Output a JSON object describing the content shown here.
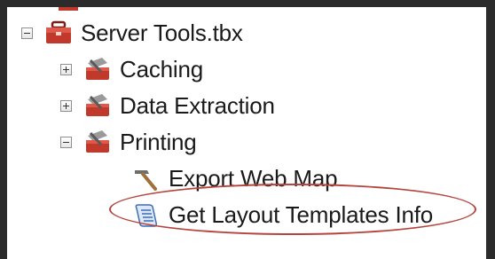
{
  "tree": {
    "root": {
      "label": "Server Tools.tbx",
      "expanded": true,
      "icon": "red-toolbox-icon"
    },
    "toolsets": [
      {
        "label": "Caching",
        "expanded": false,
        "icon": "toolset-icon"
      },
      {
        "label": "Data Extraction",
        "expanded": false,
        "icon": "toolset-icon"
      },
      {
        "label": "Printing",
        "expanded": true,
        "icon": "toolset-icon"
      }
    ],
    "tools": [
      {
        "label": "Export Web Map",
        "icon": "hammer-tool-icon"
      },
      {
        "label": "Get Layout Templates Info",
        "icon": "script-tool-icon"
      }
    ]
  },
  "colors": {
    "highlight": "#b5453c",
    "toolbox_red": "#c0392b",
    "background": "#2b2b2b"
  }
}
